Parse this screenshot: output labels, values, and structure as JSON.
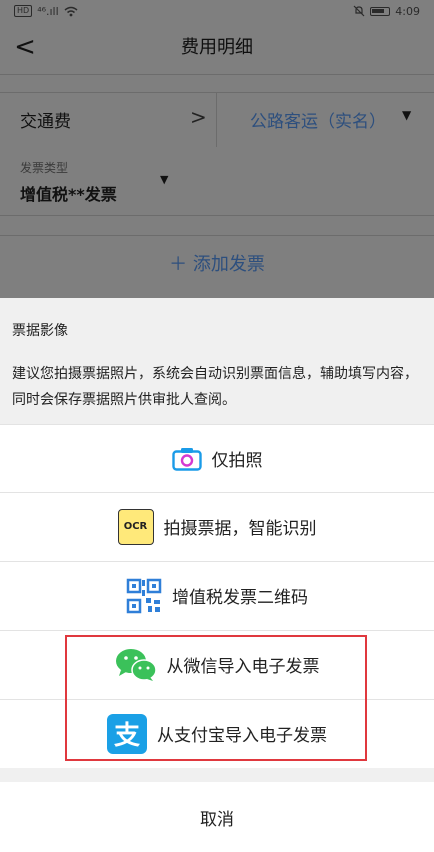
{
  "status_bar": {
    "time": "4:09",
    "hd": "HD",
    "signal": "⁴⁶.ıll"
  },
  "nav": {
    "back_glyph": "<",
    "title": "费用明细"
  },
  "form": {
    "expense_type": "交通费",
    "expense_chevron": ">",
    "expense_subtype": "公路客运（实名）",
    "invoice_type_label": "发票类型",
    "invoice_type_value": "增值税**发票",
    "dropdown_glyph": "▼",
    "add_invoice": "＋ 添加发票"
  },
  "sheet": {
    "title": "票据影像",
    "description": "建议您拍摄票据照片，系统会自动识别票面信息，辅助填写内容，同时会保存票据照片供审批人查阅。",
    "options": [
      {
        "label": "仅拍照",
        "icon": "camera-icon"
      },
      {
        "label": "拍摄票据，智能识别",
        "icon": "ocr-icon",
        "icon_text": "OCR"
      },
      {
        "label": "增值税发票二维码",
        "icon": "qr-code-icon"
      },
      {
        "label": "从微信导入电子发票",
        "icon": "wechat-icon"
      },
      {
        "label": "从支付宝导入电子发票",
        "icon": "alipay-icon",
        "icon_text": "支"
      }
    ],
    "cancel": "取消"
  },
  "colors": {
    "overlay": "#7f7f7f",
    "link_blue": "#2d4f7e",
    "highlight_red": "#e0383e",
    "camera": "#1a9be8",
    "wechat": "#3bc15a",
    "alipay": "#1aa0e6",
    "qr": "#2f7fd8"
  }
}
